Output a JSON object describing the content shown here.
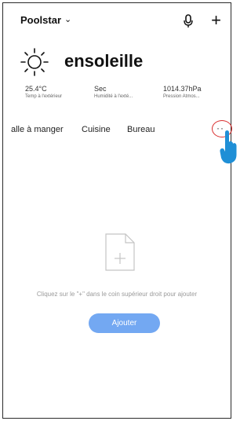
{
  "header": {
    "home_name": "Poolstar",
    "chevron_glyph": "⌄",
    "mic_icon": "microphone-icon",
    "plus_glyph": "+"
  },
  "weather": {
    "condition": "ensoleille",
    "icon": "sun-icon",
    "stats": [
      {
        "value": "25.4°C",
        "label": "Temp à l'extérieur"
      },
      {
        "value": "Sec",
        "label": "Humidité à l'exté..."
      },
      {
        "value": "1014.37hPa",
        "label": "Pression Atmos..."
      }
    ]
  },
  "rooms": {
    "tabs": [
      "alle à manger",
      "Cuisine",
      "Bureau"
    ],
    "more_glyph": "··"
  },
  "empty_state": {
    "message": "Cliquez sur le \"+\" dans le coin supérieur droit pour ajouter",
    "add_label": "Ajouter"
  },
  "colors": {
    "accent": "#73a8f2",
    "highlight_ring": "#d92c2c",
    "hand": "#1f8fd6"
  }
}
